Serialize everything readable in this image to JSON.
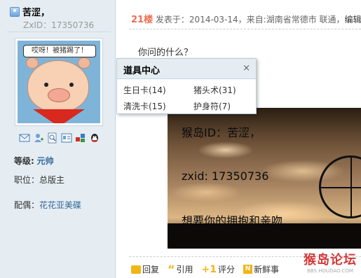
{
  "user": {
    "name": "苦涩，",
    "zxid": "ZxID：17350736",
    "avatar_caption": "哎呀！被猪踢了！",
    "level_label": "等级:",
    "level_value": "元帅",
    "role_label": "职位：",
    "role_value": "总版主",
    "spouse_label": "配偶：",
    "spouse_value": "花花亚美碟"
  },
  "profile_icons": [
    "message-icon",
    "add-friend-icon",
    "search-icon",
    "profile-card-icon",
    "medal-icon",
    "qq-icon"
  ],
  "post": {
    "floor": "21楼",
    "meta": "发表于：2014-03-14，来自:湖南省常德市 联通，",
    "edit": "编辑",
    "text": "你问的什么？",
    "image_lines": [
      "猴岛ID：苦涩，",
      "zxid: 17350736",
      "想要你的拥抱和亲吻."
    ]
  },
  "actions": {
    "reply": "回复",
    "quote": "引用",
    "rate": "评分",
    "news": "新鲜事"
  },
  "watermark": {
    "main": "猴岛论坛",
    "sub": "BBS.HOUDAO.COM"
  },
  "popup": {
    "title": "道具中心",
    "close": "×",
    "items": [
      "生日卡(14)",
      "猪头术(31)",
      "清洗卡(15)",
      "护身符(7)"
    ]
  },
  "colors": {
    "sidebar_bg": "#e5edf2",
    "floor": "#f26c4f",
    "link": "#336699",
    "accent_yellow": "#f2b516"
  }
}
